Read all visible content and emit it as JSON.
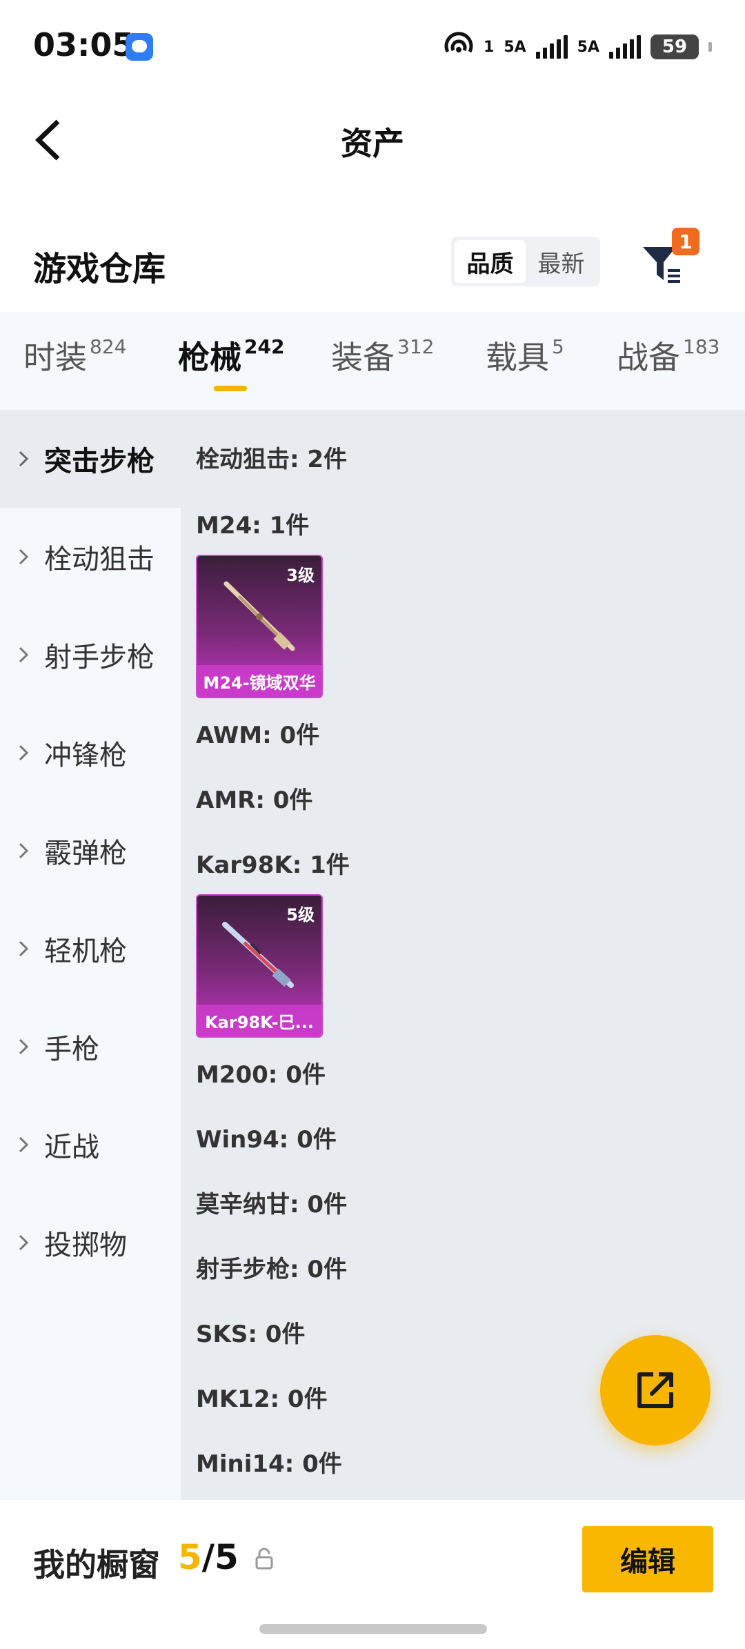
{
  "status_bar": {
    "time": "03:05",
    "network_labels": [
      "1",
      "5A",
      "5A"
    ],
    "battery": "59",
    "icons": [
      "chat-icon",
      "hotspot-icon",
      "signal-icon",
      "signal-icon",
      "battery-icon"
    ]
  },
  "header": {
    "title": "资产",
    "back_icon": "back-chevron-icon"
  },
  "section": {
    "title": "游戏仓库",
    "sort_options": [
      "品质",
      "最新"
    ],
    "sort_selected": "品质",
    "filter_badge": "1"
  },
  "tabs": [
    {
      "label": "时装",
      "count": "824"
    },
    {
      "label": "枪械",
      "count": "242"
    },
    {
      "label": "装备",
      "count": "312"
    },
    {
      "label": "载具",
      "count": "5"
    },
    {
      "label": "战备",
      "count": "183"
    }
  ],
  "active_tab": "枪械",
  "sidebar": {
    "items": [
      "突击步枪",
      "栓动狙击",
      "射手步枪",
      "冲锋枪",
      "霰弹枪",
      "轻机枪",
      "手枪",
      "近战",
      "投掷物"
    ],
    "active": "突击步枪"
  },
  "list": {
    "group_header": "栓动狙击: 2件",
    "rows": [
      {
        "label": "M24: 1件"
      },
      {
        "label": "AWM: 0件"
      },
      {
        "label": "AMR: 0件"
      },
      {
        "label": "Kar98K: 1件"
      },
      {
        "label": "M200: 0件"
      },
      {
        "label": "Win94: 0件"
      },
      {
        "label": "莫辛纳甘: 0件"
      },
      {
        "label": "射手步枪: 0件"
      },
      {
        "label": "SKS: 0件"
      },
      {
        "label": "MK12: 0件"
      },
      {
        "label": "Mini14: 0件"
      }
    ],
    "items": [
      {
        "level": "3级",
        "name": "M24-镜域双华",
        "accent": "#c537c5"
      },
      {
        "level": "5级",
        "name": "Kar98K-巳...",
        "accent": "#c537c5"
      }
    ]
  },
  "fab": {
    "icon": "share-external-icon",
    "color": "#f7b500"
  },
  "bottom_bar": {
    "label": "我的橱窗",
    "count_current": "5",
    "count_sep_total": "/5",
    "lock_icon": "lock-icon",
    "edit_label": "编辑",
    "accent": "#f9b700"
  }
}
